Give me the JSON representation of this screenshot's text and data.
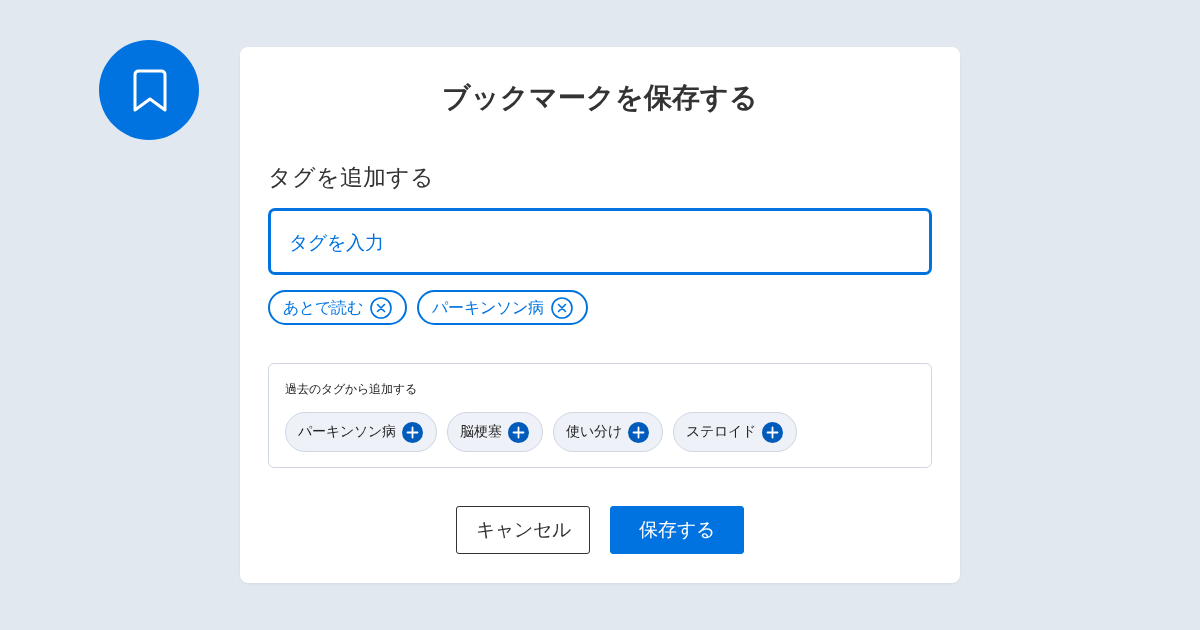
{
  "dialog": {
    "title": "ブックマークを保存する",
    "section_label": "タグを追加する",
    "tag_input": {
      "placeholder": "タグを入力",
      "focused": true
    },
    "selected_tags": [
      {
        "label": "あとで読む"
      },
      {
        "label": "パーキンソン病"
      }
    ],
    "past_tags": {
      "title": "過去のタグから追加する",
      "tags": [
        {
          "label": "パーキンソン病"
        },
        {
          "label": "脳梗塞"
        },
        {
          "label": "使い分け"
        },
        {
          "label": "ステロイド"
        }
      ]
    },
    "buttons": [
      {
        "label": "キャンセル",
        "kind": "secondary"
      },
      {
        "label": "保存する",
        "kind": "primary"
      }
    ]
  }
}
